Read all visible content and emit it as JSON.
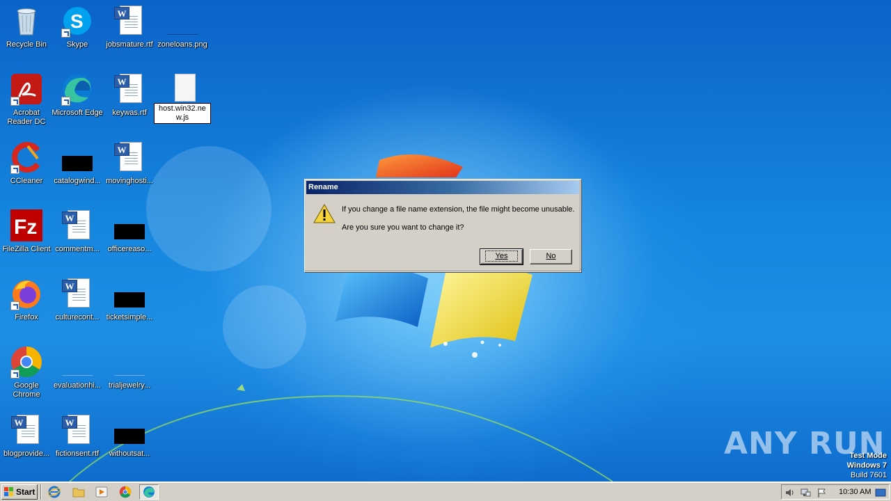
{
  "desktop": {
    "icons": [
      {
        "label": "Recycle Bin"
      },
      {
        "label": "Skype"
      },
      {
        "label": "jobsmature.rtf"
      },
      {
        "label": "zoneloans.png"
      },
      {
        "label": "Acrobat Reader DC"
      },
      {
        "label": "Microsoft Edge"
      },
      {
        "label": "keywas.rtf"
      },
      {
        "label": "host.win32.new.js"
      },
      {
        "label": "CCleaner"
      },
      {
        "label": "catalogwind..."
      },
      {
        "label": "movinghosti..."
      },
      {
        "label": "FileZilla Client"
      },
      {
        "label": "commentm..."
      },
      {
        "label": "officereaso..."
      },
      {
        "label": "Firefox"
      },
      {
        "label": "culturecont..."
      },
      {
        "label": "ticketsimple..."
      },
      {
        "label": "Google Chrome"
      },
      {
        "label": "evaluationhi..."
      },
      {
        "label": "trialjewelry..."
      },
      {
        "label": "blogprovide..."
      },
      {
        "label": "fictionsent.rtf"
      },
      {
        "label": "withoutsat..."
      }
    ]
  },
  "dialog": {
    "title": "Rename",
    "message_line1": "If you change a file name extension, the file might become unusable.",
    "message_line2": "Are you sure you want to change it?",
    "yes_label": "Yes",
    "no_label": "No"
  },
  "watermark": {
    "text": "ANY RUN",
    "line1": "Test Mode",
    "line2": "Windows 7",
    "line3": "Build 7601"
  },
  "taskbar": {
    "start_label": "Start",
    "clock": "10:30 AM"
  },
  "colors": {
    "titlebar_start": "#0a246a",
    "titlebar_end": "#a6caf0",
    "dialog_face": "#d4d0c8",
    "desktop_blue": "#1585de"
  }
}
